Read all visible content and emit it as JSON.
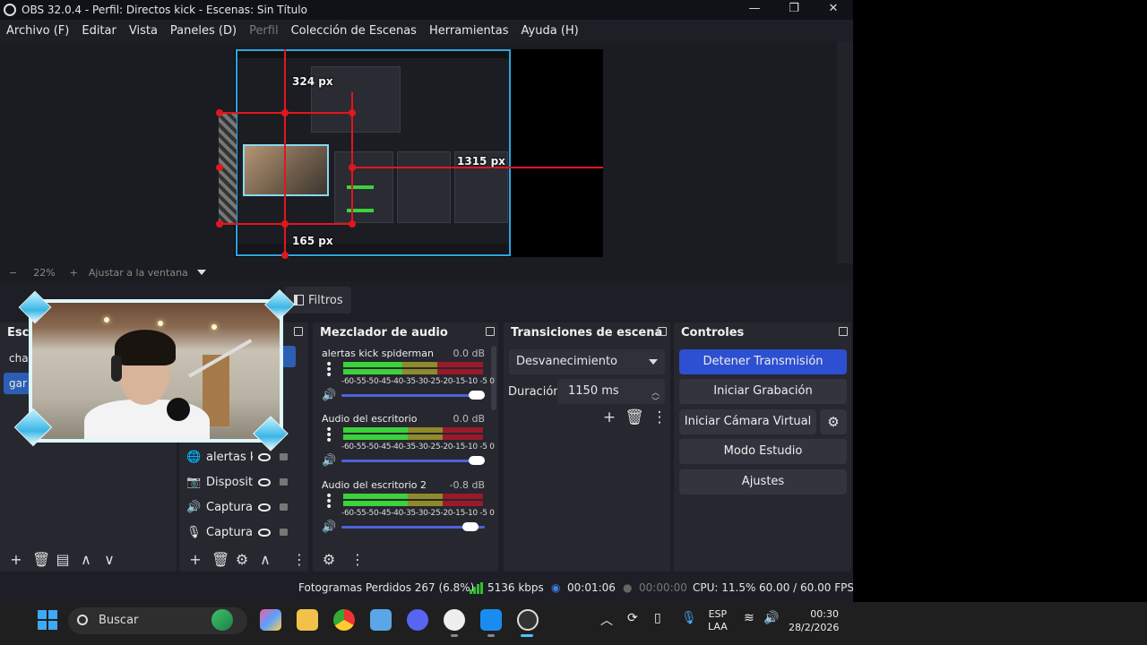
{
  "window": {
    "title": "OBS 32.0.4 - Perfil: Directos kick - Escenas: Sin Título",
    "controls": [
      "—",
      "❐",
      "✕"
    ]
  },
  "menu": [
    "Archivo (F)",
    "Editar",
    "Vista",
    "Paneles (D)",
    "Perfil",
    "Colección de Escenas",
    "Herramientas",
    "Ayuda (H)"
  ],
  "preview": {
    "measure_top": "324 px",
    "measure_right": "1315 px",
    "measure_bottom": "165 px"
  },
  "zoom": {
    "minus": "−",
    "value": "22%",
    "plus": "+",
    "fit_label": "Ajustar a la ventana"
  },
  "context": {
    "filters_label": "Filtros"
  },
  "scenes": {
    "title": "Esc",
    "items": [
      "cha",
      "gar"
    ],
    "footer": [
      "+",
      "🗑",
      "▤",
      "∧",
      "∨"
    ]
  },
  "sources": {
    "items": [
      {
        "icon": "🌐",
        "name": "alertas k"
      },
      {
        "icon": "📷",
        "name": "Dispositi"
      },
      {
        "icon": "🔊",
        "name": "Captura"
      },
      {
        "icon": "🎙",
        "name": "Captura"
      }
    ],
    "footer": [
      "+",
      "🗑",
      "⚙",
      "∧",
      "⋮"
    ]
  },
  "mixer": {
    "title": "Mezclador de audio",
    "ticks": "-60-55-50-45-40-35-30-25-20-15-10 -5 0",
    "channels": [
      {
        "name": "alertas kick spiderman",
        "db": "0.0 dB",
        "level": 0.42,
        "fader": 1.0
      },
      {
        "name": "Audio del escritorio",
        "db": "0.0 dB",
        "level": 0.46,
        "fader": 1.0
      },
      {
        "name": "Audio del escritorio 2",
        "db": "-0.8 dB",
        "level": 0.46,
        "fader": 0.95
      }
    ],
    "footer": [
      "⚙",
      "⋮"
    ]
  },
  "transitions": {
    "title": "Transiciones de escena",
    "selected": "Desvanecimiento",
    "duration_label": "Duración",
    "duration_value": "1150 ms",
    "tools": [
      "+",
      "🗑",
      "⋮"
    ]
  },
  "controls": {
    "title": "Controles",
    "stop_stream": "Detener Transmisión",
    "start_recording": "Iniciar Grabación",
    "virtual_cam": "Iniciar Cámara Virtual",
    "studio_mode": "Modo Estudio",
    "settings": "Ajustes"
  },
  "status": {
    "dropped_frames": "Fotogramas Perdidos 267 (6.8%)",
    "bitrate": "5136 kbps",
    "stream_time": "00:01:06",
    "record_time": "00:00:00",
    "cpu": "CPU: 11.5%",
    "fps": "60.00 / 60.00 FPS"
  },
  "taskbar": {
    "search_placeholder": "Buscar",
    "lang_top": "ESP",
    "lang_bottom": "LAA",
    "time": "00:30",
    "date": "28/2/2026"
  },
  "colors": {
    "accent_blue": "#2d4fd1",
    "selection_border": "#29a6e0",
    "measure_red": "#e3161d",
    "meter_green": "#3bd23b",
    "meter_yellow": "#8f8a2a",
    "meter_red": "#9a1a2a"
  }
}
